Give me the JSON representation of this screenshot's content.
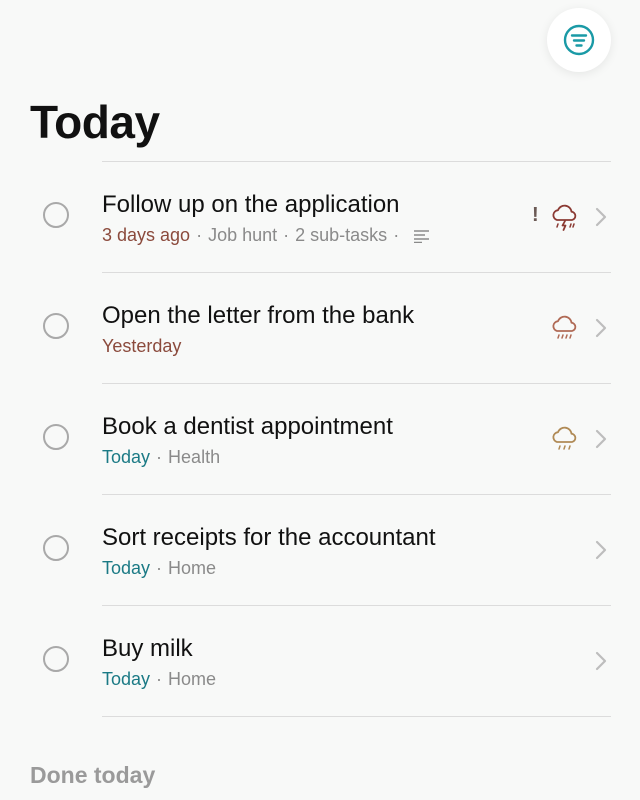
{
  "header": {
    "title": "Today",
    "filter_icon": "filter-lines-icon"
  },
  "colors": {
    "accent": "#1a9aa6",
    "overdue": "#8b4a3c",
    "today": "#1b7a85",
    "meta": "#8a8a8a",
    "weather_storm": "#8b3a33",
    "weather_rain": "#b06a55",
    "weather_light": "#b08a55"
  },
  "tasks": [
    {
      "title": "Follow up on the application",
      "due": "3 days ago",
      "project": "Job hunt",
      "subtasks": "2 sub-tasks",
      "priority": "!",
      "weather": "storm-cloud-icon",
      "has_notes": true
    },
    {
      "title": "Open the letter from the bank",
      "due": "Yesterday",
      "weather": "rain-cloud-icon"
    },
    {
      "title": "Book a dentist appointment",
      "due": "Today",
      "project": "Health",
      "weather": "drizzle-cloud-icon"
    },
    {
      "title": "Sort receipts for the accountant",
      "due": "Today",
      "project": "Home"
    },
    {
      "title": "Buy milk",
      "due": "Today",
      "project": "Home"
    }
  ],
  "done_section": {
    "title": "Done today"
  }
}
